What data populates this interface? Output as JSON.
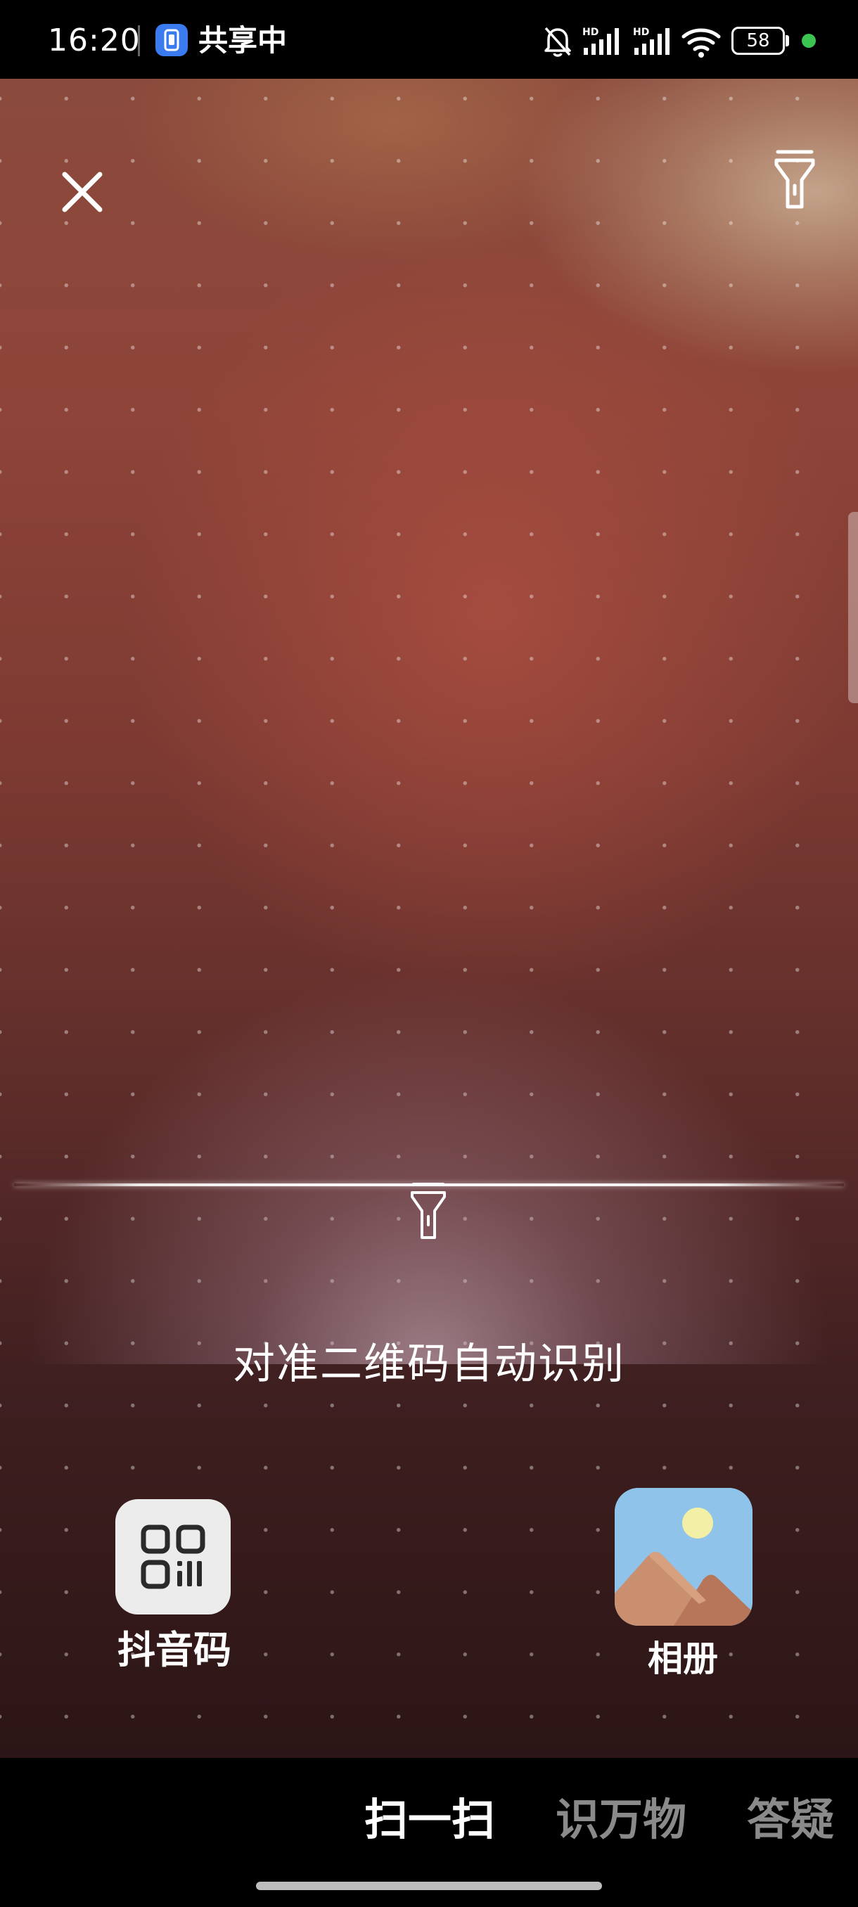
{
  "status_bar": {
    "time": "16:20",
    "sharing_label": "共享中",
    "battery_level": "58",
    "icons": [
      "screen-share-icon",
      "mute-bell-icon",
      "signal-hd-icon",
      "signal-hd-icon",
      "wifi-icon",
      "battery-icon",
      "green-dot-indicator"
    ]
  },
  "scanner": {
    "hint": "对准二维码自动识别",
    "icons": [
      "close-icon",
      "flashlight-icon"
    ]
  },
  "shortcuts": {
    "douyin_code_label": "抖音码",
    "album_label": "相册"
  },
  "modes": {
    "scan": "扫一扫",
    "identify": "识万物",
    "qa": "答疑",
    "active": "扫一扫"
  },
  "colors": {
    "accent_blue": "#3a7bf0",
    "active_tab": "#ffffff",
    "inactive_tab": "#8a8a8a",
    "status_dot": "#3cc453"
  }
}
